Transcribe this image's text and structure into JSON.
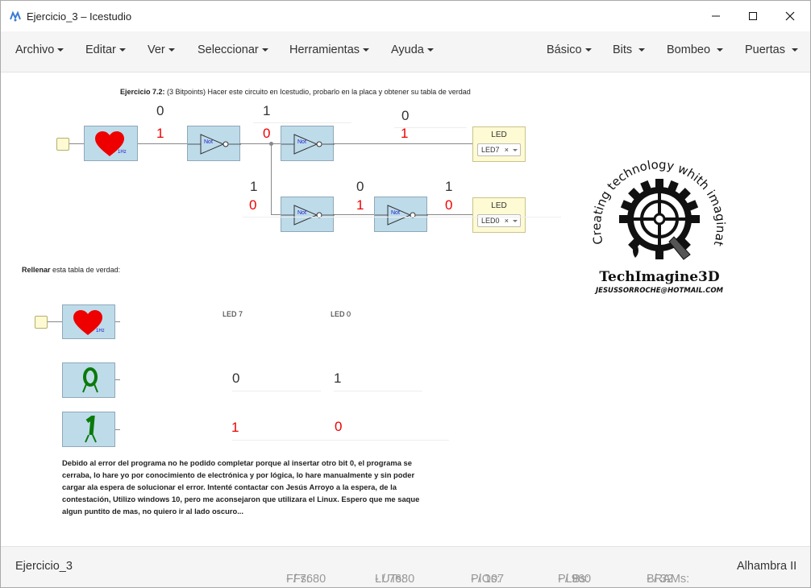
{
  "window": {
    "title": "Ejercicio_3 – Icestudio"
  },
  "menu": {
    "archivo": "Archivo",
    "editar": "Editar",
    "ver": "Ver",
    "seleccionar": "Seleccionar",
    "herramientas": "Herramientas",
    "ayuda": "Ayuda",
    "basico": "Básico",
    "bits": "Bits",
    "bombeo": "Bombeo",
    "puertas": "Puertas"
  },
  "exercise": {
    "label": "Ejercicio 7.2:",
    "text": " (3 Bitpoints) Hacer este circuito en Icestudio, probarlo en la placa y obtener su tabla de verdad"
  },
  "circuit": {
    "clock_label": "1Hz",
    "not_label": "Not",
    "values": {
      "a_top": "0",
      "a_red": "1",
      "b_top": "1",
      "b_red": "0",
      "c_top": "0",
      "c_red": "1",
      "d_top": "1",
      "d_red": "0",
      "e_top": "0",
      "e_red": "1",
      "f_top": "1",
      "f_red": "0"
    },
    "led7": {
      "title": "LED",
      "select": "LED7"
    },
    "led0": {
      "title": "LED",
      "select": "LED0"
    }
  },
  "table": {
    "fill_label": "Rellenar",
    "fill_text": " esta tabla de verdad:",
    "col_led7": "LED 7",
    "col_led0": "LED 0",
    "row0": {
      "led7": "0",
      "led0": "1"
    },
    "row1": {
      "led7": "1",
      "led0": "0"
    }
  },
  "logo": {
    "arc_text": "Creating technology whith imagination",
    "brand": "TechImagine3D",
    "email": "JESUSSORROCHE@HOTMAIL.COM"
  },
  "note": "Debido al error del programa no he podido completar porque al insertar otro bit 0, el programa se cerraba, lo hare yo por conocimiento de electrónica y por lógica, lo hare manualmente y sin poder cargar ala espera de solucionar el error. Intenté contactar con Jesús Arroyo a la espera, de la contestación, Utilizo windows 10, pero me aconsejaron que utilizara el Linux. Espero que me saque algun puntito de mas, no quiero ir al lado oscuro...",
  "status": {
    "project": "Ejercicio_3",
    "ffs_label": "FFs:",
    "ffs_value": "- / 7680",
    "luts_label": "LUTs:",
    "luts_value": "- / 7680",
    "pios_label": "PIOs:",
    "pios_value": "- / 107",
    "plbs_label": "PLBs:",
    "plbs_value": "- / 960",
    "brams_label": "BRAMs:",
    "brams_value": "- / 32",
    "board": "Alhambra II"
  },
  "colors": {
    "accent_red": "#ee0000",
    "block_blue": "#bedbea",
    "led_yellow": "#fefad3"
  }
}
